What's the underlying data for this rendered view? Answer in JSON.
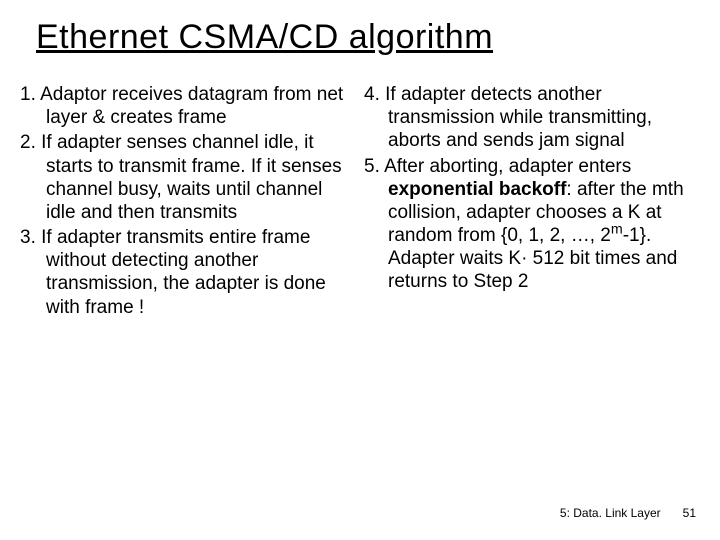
{
  "title": "Ethernet CSMA/CD algorithm",
  "left": {
    "item1_n": "1. ",
    "item1": "Adaptor receives datagram from net layer & creates frame",
    "item2_n": "2. ",
    "item2": "If adapter senses channel idle, it starts to transmit frame. If it senses channel busy, waits until channel idle and then transmits",
    "item3_n": "3. ",
    "item3": "If adapter transmits entire frame without detecting another transmission, the adapter is done with frame !"
  },
  "right": {
    "item4_n": "4. ",
    "item4": "If adapter detects another transmission while transmitting,  aborts and sends jam signal",
    "item5_n": "5. ",
    "item5_a": "After aborting, adapter enters ",
    "item5_b": "exponential backoff",
    "item5_c": ": after the mth collision, adapter chooses a K at random from {0, 1, 2, …, 2",
    "item5_sup": "m",
    "item5_d": "-1}. Adapter waits K· 512 bit times and returns to Step 2"
  },
  "footer": {
    "label": "5: Data. Link Layer",
    "page": "51"
  }
}
